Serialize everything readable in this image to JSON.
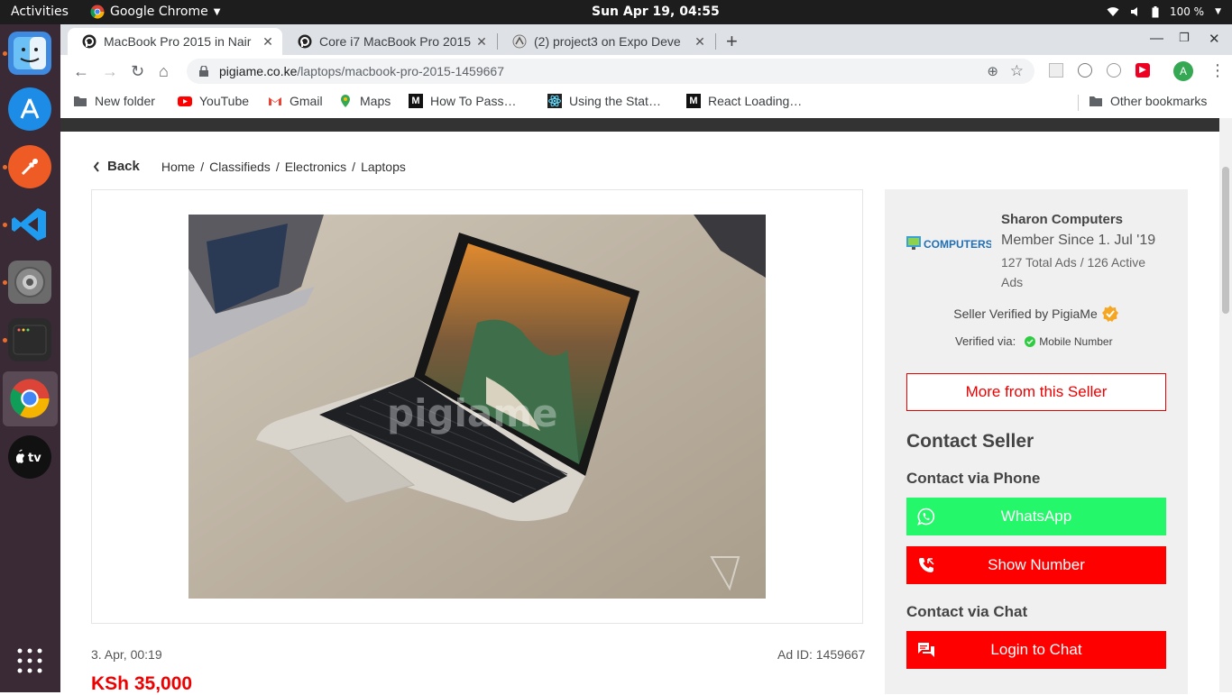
{
  "system": {
    "activities": "Activities",
    "app_name": "Google Chrome",
    "clock": "Sun Apr 19, 04:55",
    "battery": "100 %"
  },
  "browser": {
    "tabs": [
      {
        "title": "MacBook Pro 2015 in Nair",
        "active": true
      },
      {
        "title": "Core i7 MacBook Pro 2015",
        "active": false
      },
      {
        "title": "(2) project3 on Expo Deve",
        "active": false
      }
    ],
    "url_domain": "pigiame.co.ke",
    "url_path": "/laptops/macbook-pro-2015-1459667",
    "profile_initial": "A",
    "bookmarks": [
      {
        "label": "New folder",
        "icon": "folder-icon"
      },
      {
        "label": "YouTube",
        "icon": "youtube-icon"
      },
      {
        "label": "Gmail",
        "icon": "gmail-icon"
      },
      {
        "label": "Maps",
        "icon": "maps-icon"
      },
      {
        "label": "How To Pass…",
        "icon": "medium-icon"
      },
      {
        "label": "Using the Stat…",
        "icon": "react-icon"
      },
      {
        "label": "React Loading…",
        "icon": "medium-icon"
      }
    ],
    "other_bookmarks": "Other bookmarks"
  },
  "page": {
    "back_label": "Back",
    "breadcrumb": [
      "Home",
      "Classifieds",
      "Electronics",
      "Laptops"
    ],
    "posted": "3. Apr, 00:19",
    "ad_id": "Ad ID: 1459667",
    "price": "KSh 35,000",
    "watermark": "pigiame"
  },
  "seller": {
    "logo_text": "COMPUTERS",
    "name": "Sharon Computers",
    "member_since": "Member Since 1. Jul '19",
    "ads": "127 Total Ads / 126 Active Ads",
    "verified_by": "Seller Verified by PigiaMe",
    "verified_via_label": "Verified via:",
    "verified_via_value": "Mobile Number",
    "more_button": "More from this Seller",
    "contact_title": "Contact Seller",
    "contact_phone_title": "Contact via Phone",
    "whatsapp_button": "WhatsApp",
    "show_number_button": "Show Number",
    "contact_chat_title": "Contact via Chat",
    "login_chat_button": "Login to Chat"
  },
  "colors": {
    "accent_red": "#ff0000",
    "whatsapp_green": "#25f76a",
    "price_red": "#e00000",
    "dock_bg": "#3a2a36"
  }
}
